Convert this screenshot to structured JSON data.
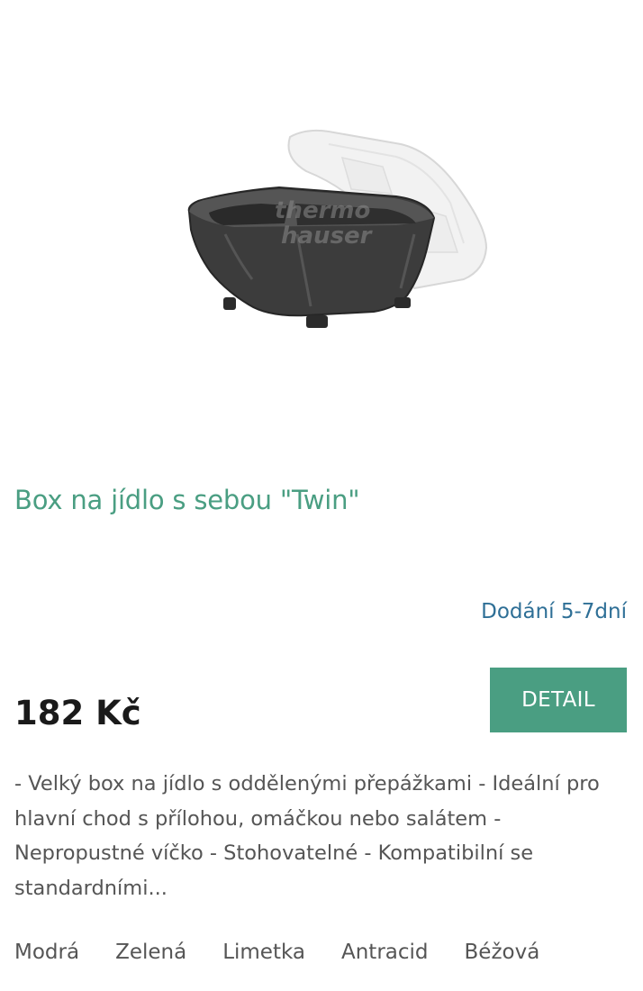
{
  "product": {
    "title": "Box na jídlo s sebou \"Twin\"",
    "delivery": "Dodání 5-7dní",
    "price": "182 Kč",
    "detail_label": "DETAIL",
    "description": "- Velký box na jídlo s oddělenými přepážkami - Ideální pro hlavní chod s přílohou, omáčkou nebo salátem - Nepropustné víčko - Stohovatelné - Kompatibilní se standardními...",
    "image_watermark": "thermo hauser",
    "colors": [
      "Modrá",
      "Zelená",
      "Limetka",
      "Antracid",
      "Béžová"
    ]
  },
  "theme": {
    "accent": "#4a9e82",
    "delivery_color": "#2e6f96",
    "price_color": "#1a1a1a",
    "text_color": "#555555"
  }
}
